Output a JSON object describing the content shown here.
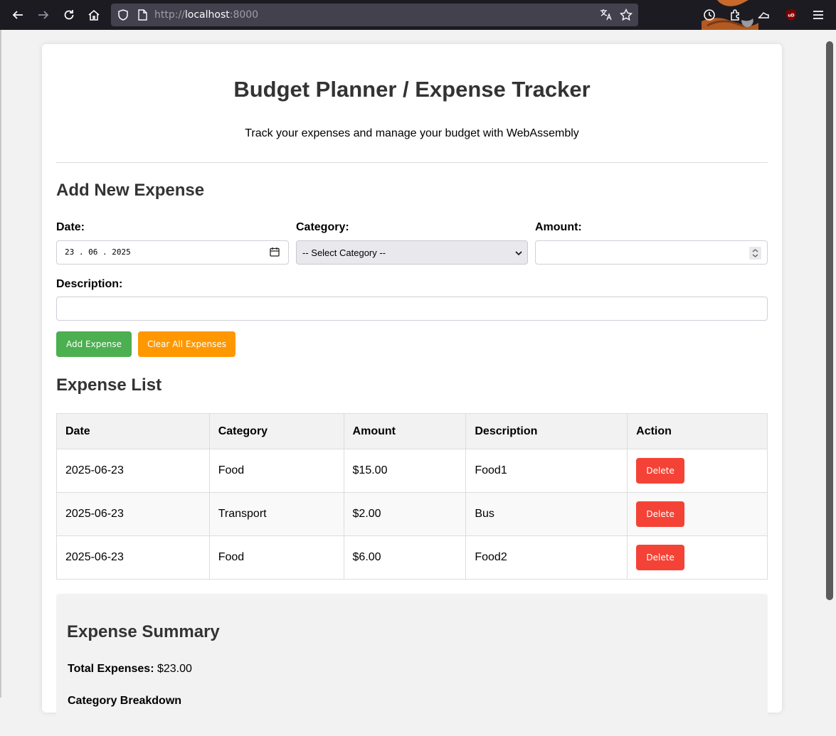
{
  "browser": {
    "url_scheme": "http://",
    "url_host": "localhost",
    "url_port": ":8000"
  },
  "page": {
    "title": "Budget Planner / Expense Tracker",
    "subtitle": "Track your expenses and manage your budget with WebAssembly"
  },
  "form": {
    "heading": "Add New Expense",
    "date_label": "Date:",
    "date_value": "23 . 06 . 2025",
    "category_label": "Category:",
    "category_value": "-- Select Category --",
    "amount_label": "Amount:",
    "amount_value": "",
    "description_label": "Description:",
    "description_value": "",
    "add_button": "Add Expense",
    "clear_button": "Clear All Expenses"
  },
  "list": {
    "heading": "Expense List",
    "columns": [
      "Date",
      "Category",
      "Amount",
      "Description",
      "Action"
    ],
    "rows": [
      {
        "date": "2025-06-23",
        "category": "Food",
        "amount": "$15.00",
        "description": "Food1",
        "action": "Delete"
      },
      {
        "date": "2025-06-23",
        "category": "Transport",
        "amount": "$2.00",
        "description": "Bus",
        "action": "Delete"
      },
      {
        "date": "2025-06-23",
        "category": "Food",
        "amount": "$6.00",
        "description": "Food2",
        "action": "Delete"
      }
    ]
  },
  "summary": {
    "heading": "Expense Summary",
    "total_label": "Total Expenses:",
    "total_value": "$23.00",
    "breakdown_label": "Category Breakdown"
  },
  "colors": {
    "add_button": "#4caf50",
    "clear_button": "#ff9800",
    "delete_button": "#f44336"
  }
}
